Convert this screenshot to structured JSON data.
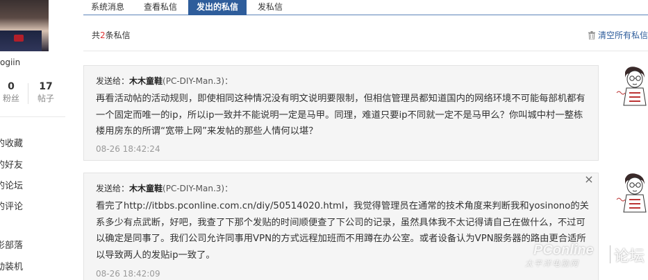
{
  "sidebar": {
    "username": "ogiin",
    "stats": [
      {
        "num": "0",
        "label": "粉丝"
      },
      {
        "num": "17",
        "label": "帖子"
      }
    ],
    "items": [
      {
        "label": "的收藏"
      },
      {
        "label": "的好友"
      },
      {
        "label": "的论坛"
      },
      {
        "label": "的评论"
      },
      {
        "label": "影部落"
      },
      {
        "label": "动装机"
      }
    ]
  },
  "tabs": [
    {
      "label": "系统消息",
      "active": false
    },
    {
      "label": "查看私信",
      "active": false
    },
    {
      "label": "发出的私信",
      "active": true
    },
    {
      "label": "发私信",
      "active": false
    }
  ],
  "count": {
    "prefix": "共",
    "num": "2",
    "suffix": "条私信"
  },
  "clear_all_label": "清空所有私信",
  "messages": [
    {
      "to_label": "发送给：",
      "recipient": "木木童鞋",
      "recipient_id": "(PC-DIY-Man.3)：",
      "body": "再看活动帖的活动规则，即使相同这种情况没有明文说明要限制，但相信管理员都知道国内的网络环境不可能每部机都有一个固定而唯一的ip，所以ip一致并不能说明一定是马甲。同理，难道只要ip不同就一定不是马甲么？你叫城中村一整栋楼用房东的所谓“宽带上网”来发帖的那些人情何以堪？",
      "time": "08-26 18:42:24"
    },
    {
      "to_label": "发送给：",
      "recipient": "木木童鞋",
      "recipient_id": "(PC-DIY-Man.3)：",
      "body": "看完了http://itbbs.pconline.com.cn/diy/50514020.html，我觉得管理员在通常的技术角度来判断我和yosinono的关系多少有点武断，好吧，我查了下那个发贴的时间顺便查了下公司的记录，虽然具体我不太记得请自己在做什么，不过可以确定是同事了。我们公司允许同事用VPN的方式远程加班而不用蹲在办公室。或者设备认为VPN服务器的路由更合适所以导致两人的发贴ip一致了。",
      "time": "08-26 18:42:09"
    }
  ],
  "close_icon_glyph": "×",
  "watermark": {
    "logo": "PConline",
    "sub": "太平洋电脑网",
    "forum": "论坛"
  },
  "colors": {
    "accent": "#2e5d9b",
    "count_highlight": "#dd3333",
    "msg_bg": "#f5f5f5"
  }
}
